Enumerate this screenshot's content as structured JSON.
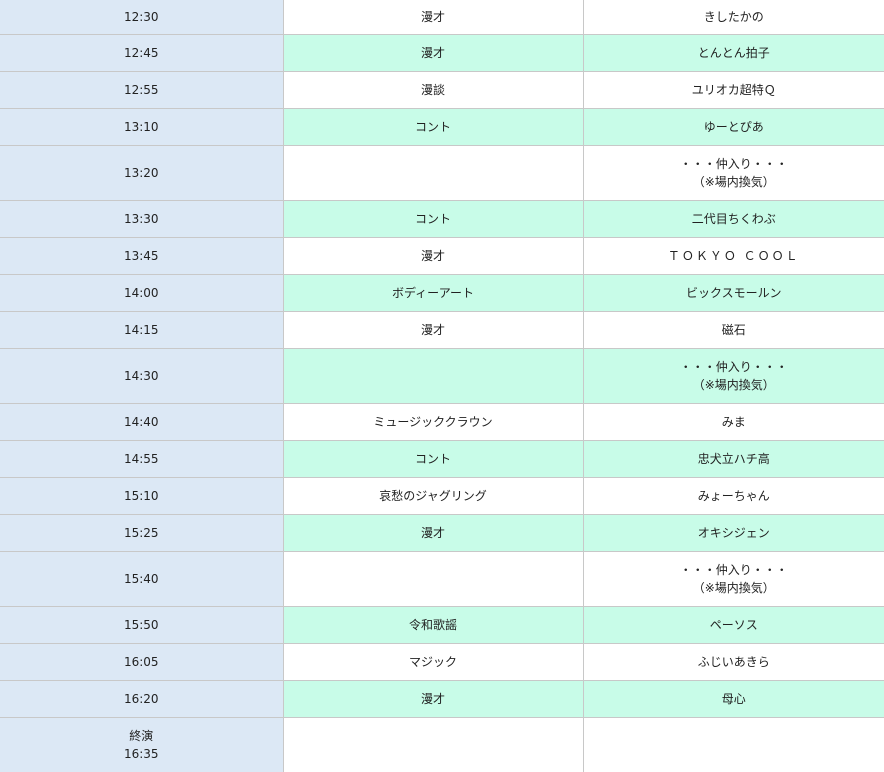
{
  "colors": {
    "time_column_bg": "#dce8f5",
    "alt_row_bg": "#c8fce8",
    "plain_row_bg": "#ffffff",
    "border": "#c8c8c8"
  },
  "rows": [
    {
      "time": "12:30",
      "genre": "漫才",
      "performer": [
        "きしたかの"
      ]
    },
    {
      "time": "12:45",
      "genre": "漫才",
      "performer": [
        "とんとん拍子"
      ]
    },
    {
      "time": "12:55",
      "genre": "漫談",
      "performer": [
        "ユリオカ超特Ｑ"
      ]
    },
    {
      "time": "13:10",
      "genre": "コント",
      "performer": [
        "ゆーとぴあ"
      ]
    },
    {
      "time": "13:20",
      "genre": "",
      "performer": [
        "・・・仲入り・・・",
        "（※場内換気）"
      ]
    },
    {
      "time": "13:30",
      "genre": "コント",
      "performer": [
        "二代目ちくわぶ"
      ]
    },
    {
      "time": "13:45",
      "genre": "漫才",
      "performer": [
        "ＴＯＫＹＯ ＣＯＯＬ"
      ]
    },
    {
      "time": "14:00",
      "genre": "ボディーアート",
      "performer": [
        "ビックスモールン"
      ]
    },
    {
      "time": "14:15",
      "genre": "漫才",
      "performer": [
        "磁石"
      ]
    },
    {
      "time": "14:30",
      "genre": "",
      "performer": [
        "・・・仲入り・・・",
        "（※場内換気）"
      ]
    },
    {
      "time": "14:40",
      "genre": "ミュージッククラウン",
      "performer": [
        "みま"
      ]
    },
    {
      "time": "14:55",
      "genre": "コント",
      "performer": [
        "忠犬立ハチ高"
      ]
    },
    {
      "time": "15:10",
      "genre": "哀愁のジャグリング",
      "performer": [
        "みょーちゃん"
      ]
    },
    {
      "time": "15:25",
      "genre": "漫才",
      "performer": [
        "オキシジェン"
      ]
    },
    {
      "time": "15:40",
      "genre": "",
      "performer": [
        "・・・仲入り・・・",
        "（※場内換気）"
      ]
    },
    {
      "time": "15:50",
      "genre": "令和歌謡",
      "performer": [
        "ペーソス"
      ]
    },
    {
      "time": "16:05",
      "genre": "マジック",
      "performer": [
        "ふじいあきら"
      ]
    },
    {
      "time": "16:20",
      "genre": "漫才",
      "performer": [
        "母心"
      ]
    }
  ],
  "finale": {
    "label": "終演",
    "time": "16:35"
  }
}
